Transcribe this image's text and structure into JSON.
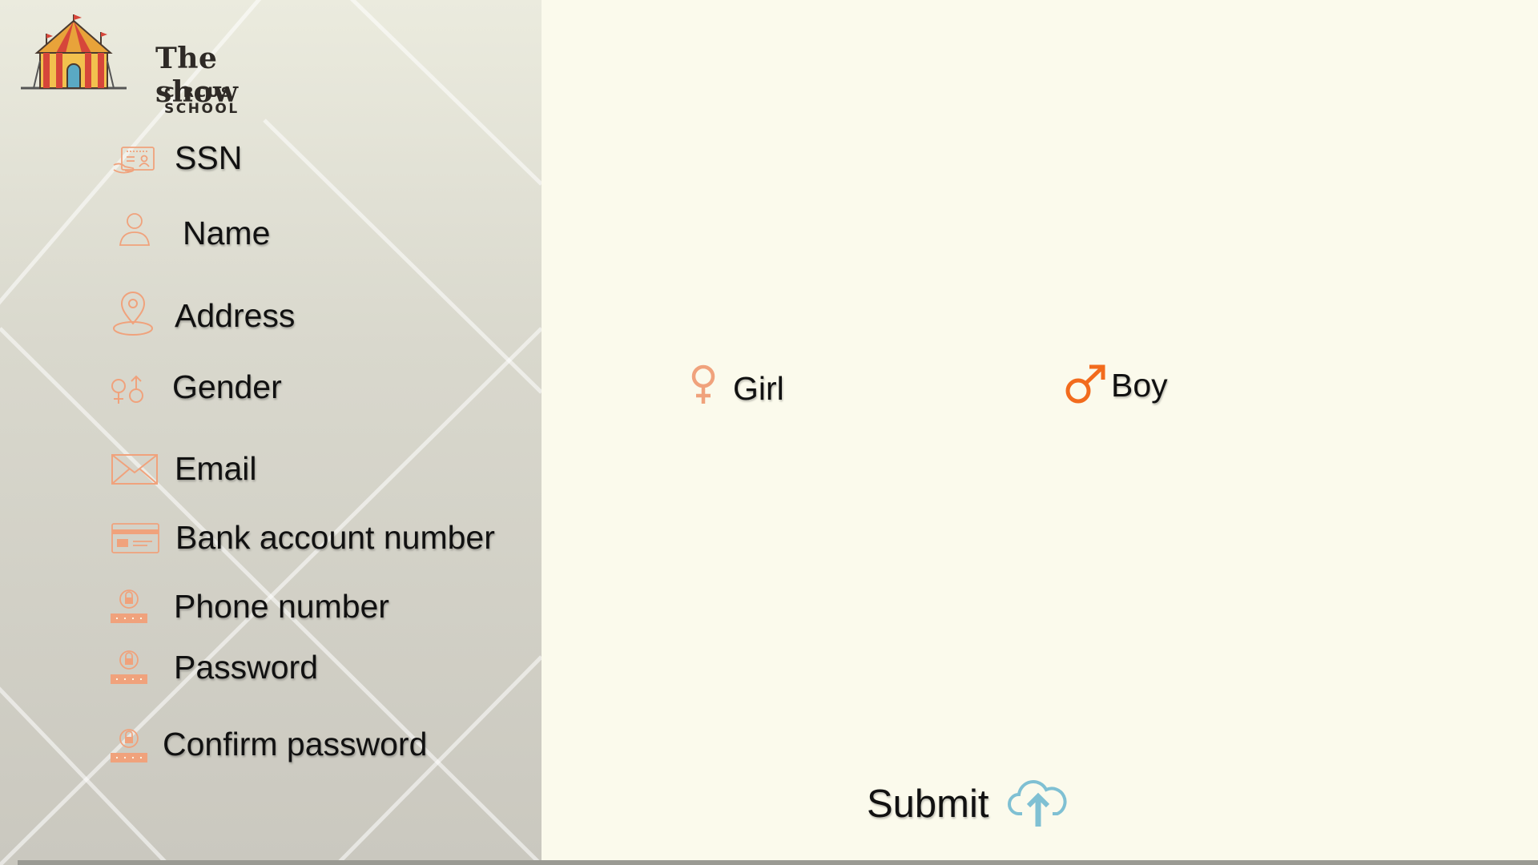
{
  "brand": {
    "title": "The show",
    "subtitle": "CIRCUS SCHOOL"
  },
  "form_fields": [
    {
      "label": "SSN",
      "icon": "id-card-icon"
    },
    {
      "label": "Name",
      "icon": "user-icon"
    },
    {
      "label": "Address",
      "icon": "location-pin-icon"
    },
    {
      "label": "Gender",
      "icon": "gender-icon"
    },
    {
      "label": "Email",
      "icon": "envelope-icon"
    },
    {
      "label": "Bank account number",
      "icon": "bank-card-icon"
    },
    {
      "label": "Phone number",
      "icon": "lock-keypad-icon"
    },
    {
      "label": "Password",
      "icon": "lock-keypad-icon"
    },
    {
      "label": "Confirm password",
      "icon": "lock-keypad-icon"
    }
  ],
  "gender_options": {
    "girl": {
      "label": "Girl",
      "icon": "female-symbol-icon"
    },
    "boy": {
      "label": "Boy",
      "icon": "male-symbol-icon"
    }
  },
  "submit": {
    "label": "Submit",
    "icon": "cloud-upload-icon"
  },
  "colors": {
    "icon_orange": "#f0a27c",
    "boy_orange": "#f26b1d",
    "submit_teal": "#7fc0d3",
    "content_bg": "#fbfaec"
  }
}
